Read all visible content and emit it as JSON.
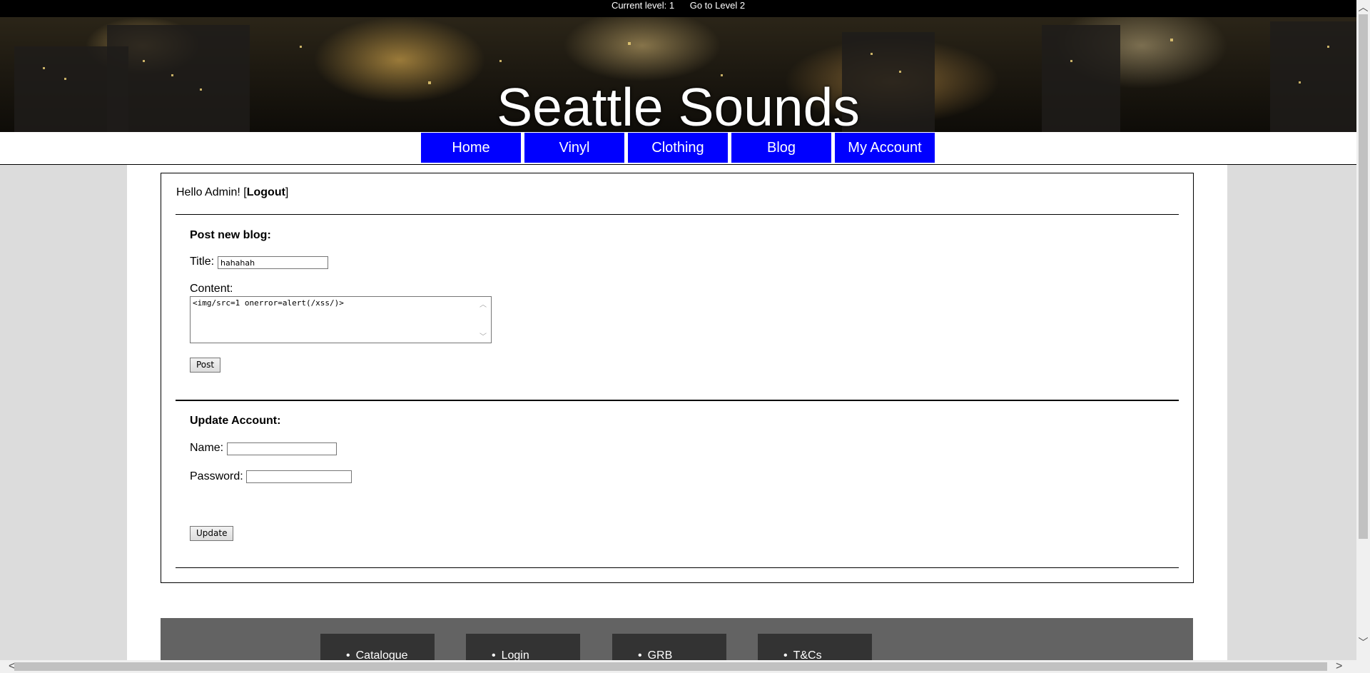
{
  "topbar": {
    "current_level": "Current level: 1",
    "next_level": "Go to Level 2"
  },
  "site_title": "Seattle Sounds",
  "nav": {
    "items": [
      "Home",
      "Vinyl",
      "Clothing",
      "Blog",
      "My Account"
    ]
  },
  "account": {
    "greeting": "Hello Admin! [",
    "logout": "Logout",
    "greeting_end": "]"
  },
  "blog_form": {
    "heading": "Post new blog:",
    "title_label": "Title:",
    "title_value": "hahahah",
    "content_label": "Content:",
    "content_value": "<img/src=1 onerror=alert(/xss/)>",
    "submit_label": "Post"
  },
  "update_form": {
    "heading": "Update Account:",
    "name_label": "Name:",
    "name_value": "",
    "password_label": "Password:",
    "password_value": "",
    "submit_label": "Update"
  },
  "footer": {
    "items": [
      "Catalogue",
      "Login",
      "GRB",
      "T&Cs"
    ]
  }
}
